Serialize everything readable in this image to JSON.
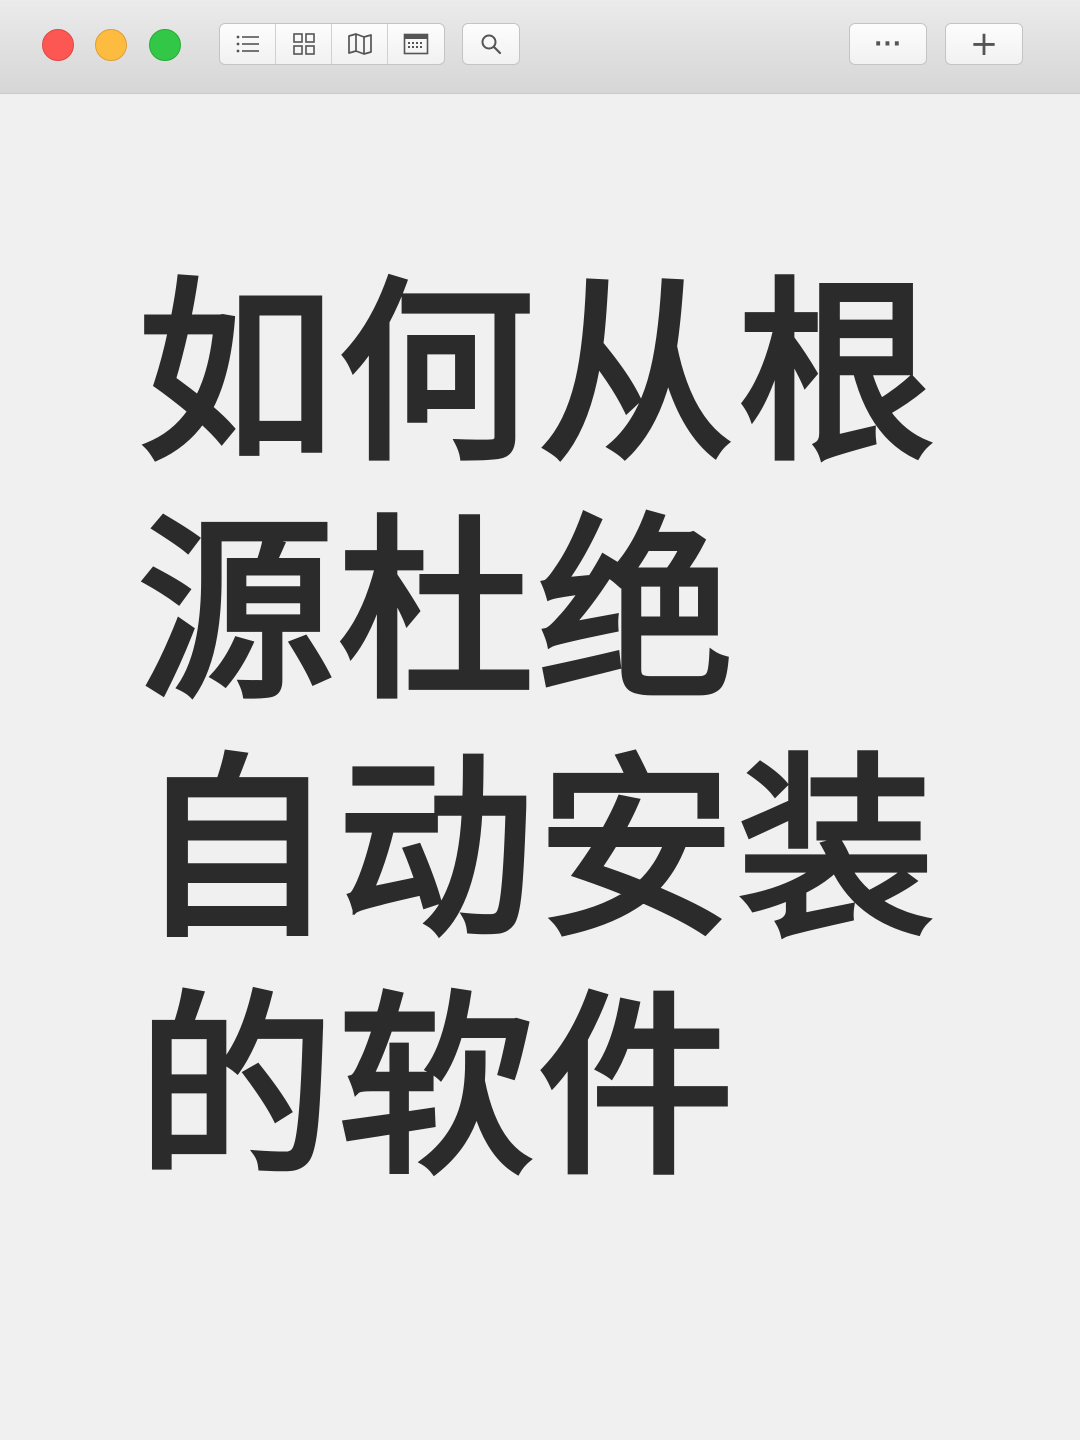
{
  "window": {
    "controls": [
      "close",
      "minimize",
      "zoom"
    ]
  },
  "toolbar": {
    "view_buttons": [
      {
        "name": "list-view",
        "icon": "list-icon"
      },
      {
        "name": "grid-view",
        "icon": "grid-icon"
      },
      {
        "name": "map-view",
        "icon": "map-icon"
      },
      {
        "name": "calendar-view",
        "icon": "calendar-icon"
      }
    ],
    "search_icon": "search-icon",
    "more_label": "···",
    "add_label": "+"
  },
  "content": {
    "headline_lines": [
      "如何从根",
      "源杜绝",
      "自动安装",
      "的软件"
    ]
  },
  "colors": {
    "close": "#fc5753",
    "minimize": "#fdbc40",
    "zoom": "#33c748",
    "text": "#2b2b2b",
    "background": "#f0f0f0"
  }
}
